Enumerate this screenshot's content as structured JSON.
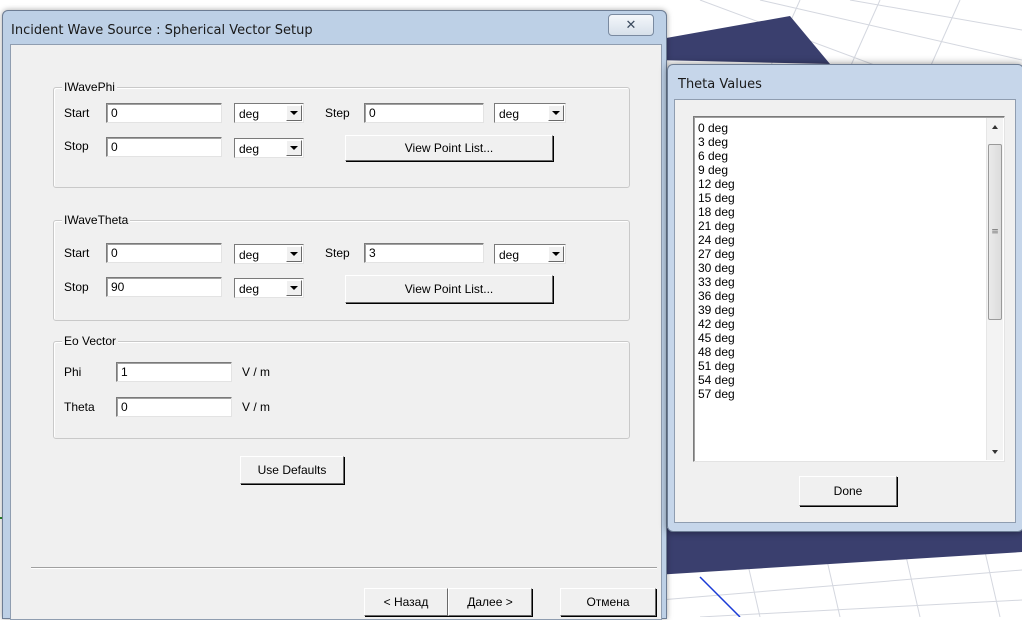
{
  "main_dialog": {
    "title": "Incident Wave Source : Spherical Vector Setup",
    "close_glyph": "✕",
    "phi_group": {
      "legend": "IWavePhi",
      "start_label": "Start",
      "start_value": "0",
      "start_unit": "deg",
      "step_label": "Step",
      "step_value": "0",
      "step_unit": "deg",
      "stop_label": "Stop",
      "stop_value": "0",
      "stop_unit": "deg",
      "view_button": "View Point List..."
    },
    "theta_group": {
      "legend": "IWaveTheta",
      "start_label": "Start",
      "start_value": "0",
      "start_unit": "deg",
      "step_label": "Step",
      "step_value": "3",
      "step_unit": "deg",
      "stop_label": "Stop",
      "stop_value": "90",
      "stop_unit": "deg",
      "view_button": "View Point List..."
    },
    "eo_group": {
      "legend": "Eo Vector",
      "phi_label": "Phi",
      "phi_value": "1",
      "phi_unit": "V / m",
      "theta_label": "Theta",
      "theta_value": "0",
      "theta_unit": "V / m"
    },
    "use_defaults_button": "Use Defaults",
    "back_button": "< Назад",
    "next_button": "Далее >",
    "cancel_button": "Отмена"
  },
  "theta_dialog": {
    "title": "Theta Values",
    "items": [
      "0 deg",
      "3 deg",
      "6 deg",
      "9 deg",
      "12 deg",
      "15 deg",
      "18 deg",
      "21 deg",
      "24 deg",
      "27 deg",
      "30 deg",
      "33 deg",
      "36 deg",
      "39 deg",
      "42 deg",
      "45 deg",
      "48 deg",
      "51 deg",
      "54 deg",
      "57 deg"
    ],
    "done_button": "Done",
    "scroll_position": 0
  },
  "colors": {
    "frame": "#bdd0e6",
    "client": "#f0f0f0",
    "background_plane": "#3a3f6e",
    "grid_line": "#c9ccd6",
    "axis_line": "#1a3bd6"
  },
  "icons": {
    "close": "close-icon",
    "dropdown": "chevron-down-icon",
    "scroll_up": "scroll-up-arrow-icon",
    "scroll_down": "scroll-down-arrow-icon",
    "scroll_grip": "scroll-grip-icon"
  }
}
